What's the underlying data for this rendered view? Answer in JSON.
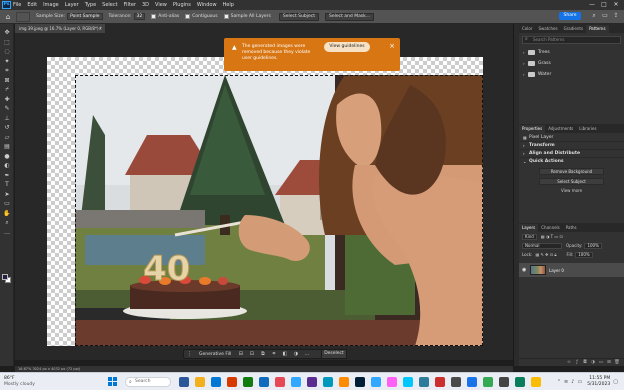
{
  "menubar": {
    "app_logo": "Ps",
    "items": [
      "File",
      "Edit",
      "Image",
      "Layer",
      "Type",
      "Select",
      "Filter",
      "3D",
      "View",
      "Plugins",
      "Window",
      "Help"
    ],
    "window_controls": [
      "—",
      "□",
      "✕"
    ]
  },
  "options": {
    "sample_size_label": "Sample Size:",
    "sample_size_value": "Point Sample",
    "tolerance_label": "Tolerance:",
    "tolerance_value": "32",
    "anti_alias_label": "Anti-alias",
    "contiguous_label": "Contiguous",
    "sample_all_layers_label": "Sample All Layers",
    "select_subject_label": "Select Subject",
    "select_and_mask_label": "Select and Mask...",
    "share_label": "Share",
    "icons": [
      "search-icon",
      "workspace-icon",
      "share-arrange-icon"
    ]
  },
  "document": {
    "tab_title": "img 39.jpeg @ 16.7% (Layer 0, RGB/8*) *",
    "zoom_status": "16.67%     3024 px x 4032 px (72 ppi)"
  },
  "notice": {
    "message": "The generated images were removed because they violate user guidelines.",
    "button_label": "View guidelines"
  },
  "contextual_taskbar": {
    "generative_fill_label": "Generative Fill",
    "deselect_label": "Deselect",
    "icons": [
      "subtract-icon",
      "transform-icon",
      "invert-icon",
      "crop-icon",
      "mask-icon",
      "fill-icon",
      "more-icon"
    ]
  },
  "panels": {
    "top_tabs": [
      "Color",
      "Swatches",
      "Gradients",
      "Patterns"
    ],
    "top_active": "Patterns",
    "search_placeholder": "Search Patterns",
    "folders": [
      "Trees",
      "Grass",
      "Water"
    ],
    "mid_tabs": [
      "Properties",
      "Adjustments",
      "Libraries"
    ],
    "mid_active": "Properties",
    "pixel_layer_label": "Pixel Layer",
    "sections": [
      "Transform",
      "Align and Distribute",
      "Quick Actions"
    ],
    "remove_background_label": "Remove Background",
    "select_subject_label": "Select Subject",
    "view_more_label": "View more",
    "layer_tabs": [
      "Layers",
      "Channels",
      "Paths"
    ],
    "layer_active": "Layers",
    "kind_label": "Kind",
    "blend_mode": "Normal",
    "opacity_label": "Opacity:",
    "opacity_value": "100%",
    "lock_label": "Lock:",
    "fill_label": "Fill:",
    "fill_value": "100%",
    "layer_name": "Layer 0"
  },
  "taskbar": {
    "temperature": "86°F",
    "weather": "Mostly cloudy",
    "search_placeholder": "Search",
    "time": "11:55 PM",
    "date": "5/31/2023",
    "apps": [
      "#2b579a",
      "#f2b01e",
      "#0078d4",
      "#d83b01",
      "#107c10",
      "#0f6cbd",
      "#e74856",
      "#31a8ff",
      "#5c2d91",
      "#0099bc",
      "#ff8c00",
      "#001e36",
      "#31a8ff",
      "#ff61f6",
      "#00c8ff",
      "#2d7d9a",
      "#cc2d2d",
      "#4a4a4a",
      "#1a73e8",
      "#34a853",
      "#444444",
      "#0a7e5a",
      "#fbbc05"
    ]
  }
}
